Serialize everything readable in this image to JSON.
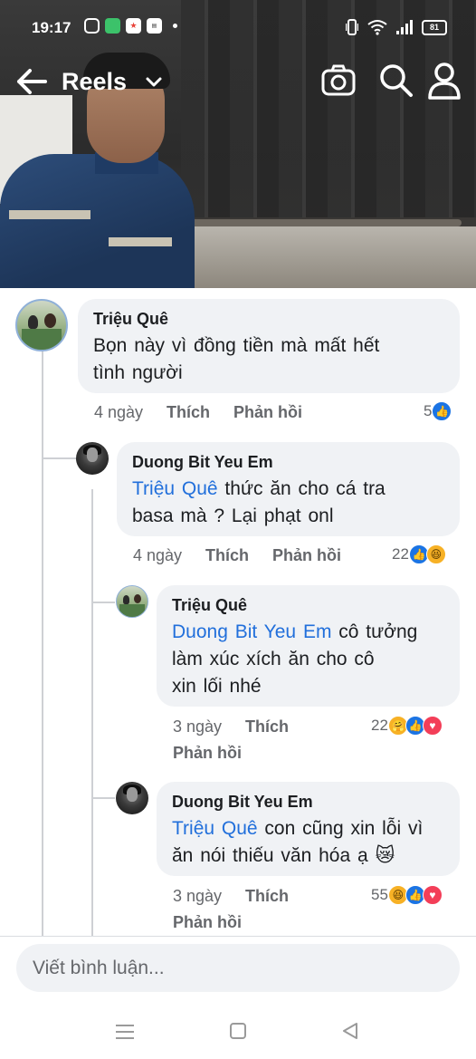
{
  "status": {
    "time": "19:17",
    "battery": "81"
  },
  "header": {
    "title": "Reels"
  },
  "comments": [
    {
      "author": "Triệu Quê",
      "mention": "",
      "text": "Bọn này vì đồng tiền mà mất hết\ntình người",
      "time": "4 ngày",
      "like": "Thích",
      "reply": "Phản hồi",
      "reactions": "5"
    },
    {
      "author": "Duong Bit Yeu Em",
      "mention": "Triệu Quê",
      "text": " thức ăn cho cá tra\nbasa mà ? Lại phạt onl",
      "time": "4 ngày",
      "like": "Thích",
      "reply": "Phản hồi",
      "reactions": "22"
    },
    {
      "author": "Triệu Quê",
      "mention": "Duong Bit Yeu Em",
      "text": " cô tưởng\nlàm xúc xích ăn cho cô\nxin lối nhé",
      "time": "3 ngày",
      "like": "Thích",
      "reply": "Phản hồi",
      "reactions": "22"
    },
    {
      "author": "Duong Bit Yeu Em",
      "mention": "Triệu Quê",
      "text": " con cũng xin lỗi vì\năn nói thiếu văn hóa ạ 😿",
      "time": "3 ngày",
      "like": "Thích",
      "reply": "Phản hồi",
      "reactions": "55"
    }
  ],
  "composer": {
    "placeholder": "Viết bình luận..."
  },
  "colors": {
    "mention": "#216fdb",
    "bubble": "#f0f2f5",
    "meta": "#65676b",
    "like": "#1b74e4"
  }
}
